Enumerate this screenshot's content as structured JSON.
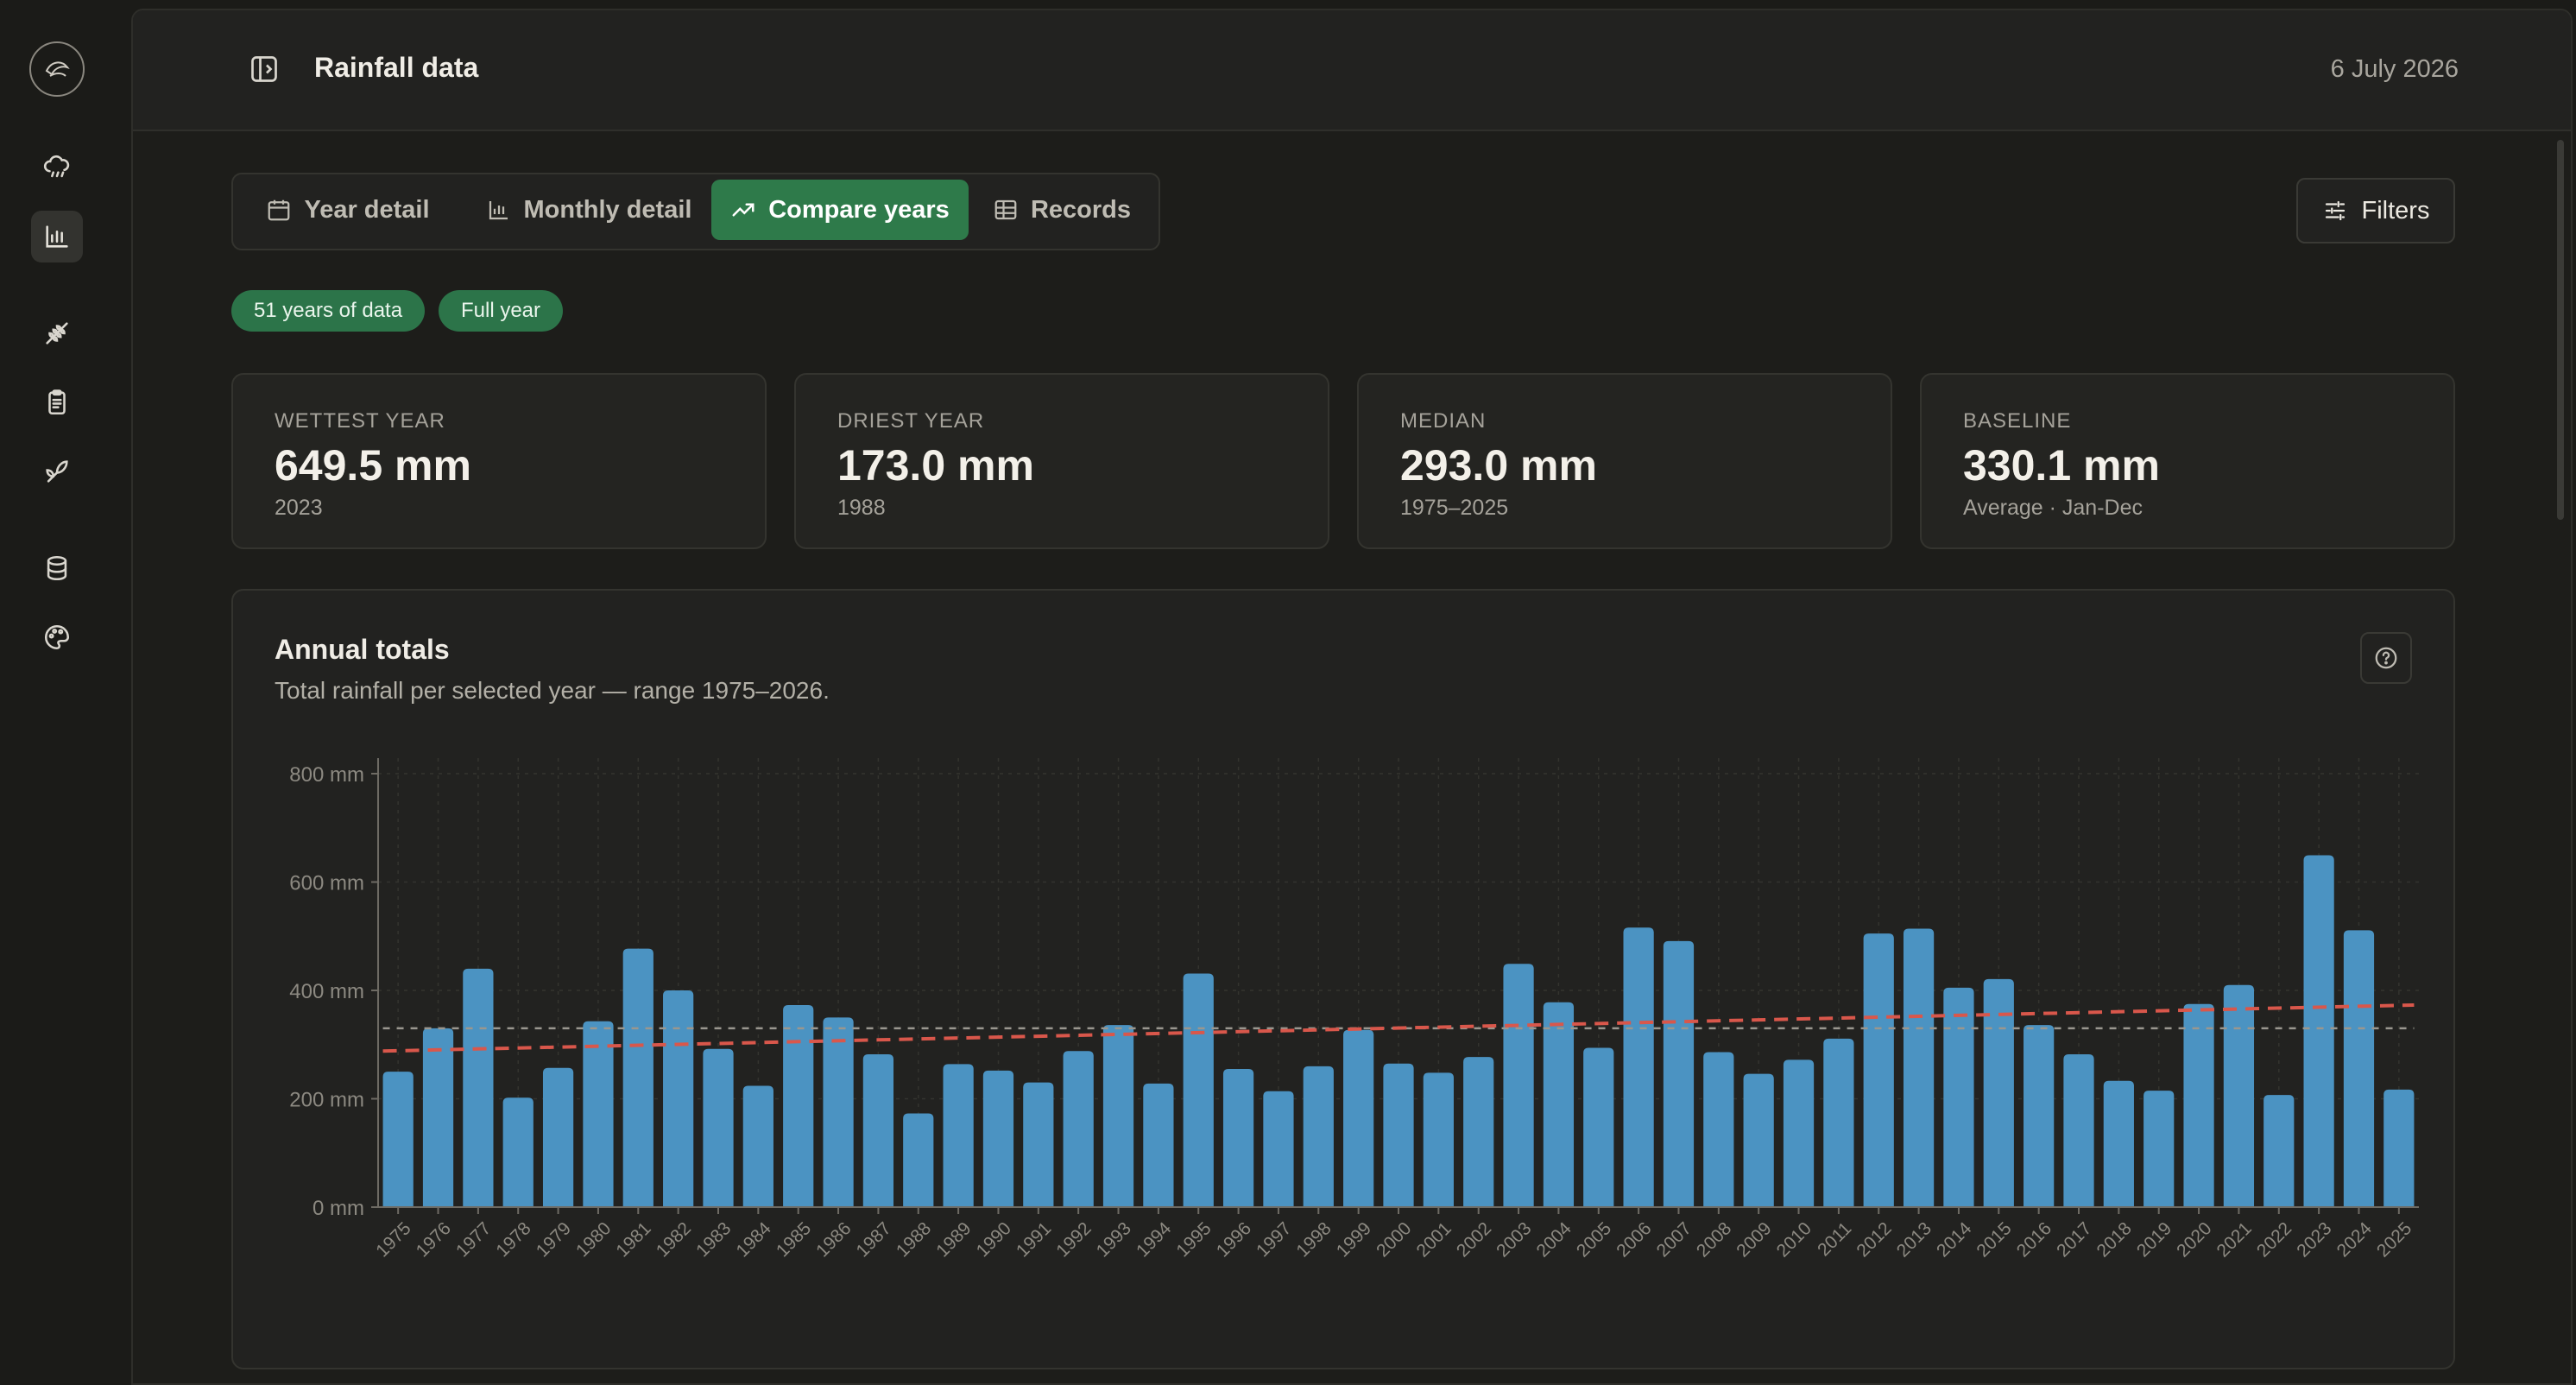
{
  "app": {
    "title": "Rainfall data",
    "date": "6 July 2026"
  },
  "rail": {
    "items": [
      {
        "icon": "logo-icon"
      },
      {
        "icon": "cloud-rain-icon"
      },
      {
        "icon": "bar-chart-icon",
        "active": true
      },
      {
        "icon": "wheat-icon"
      },
      {
        "icon": "clipboard-icon"
      },
      {
        "icon": "sprout-icon"
      },
      {
        "icon": "database-icon"
      },
      {
        "icon": "palette-icon"
      }
    ]
  },
  "tabs": [
    {
      "label": "Year detail",
      "icon": "calendar-icon"
    },
    {
      "label": "Monthly detail",
      "icon": "bar-chart-icon"
    },
    {
      "label": "Compare years",
      "icon": "trending-up-icon",
      "active": true
    },
    {
      "label": "Records",
      "icon": "table-icon"
    }
  ],
  "filters": {
    "label": "Filters",
    "icon": "sliders-icon"
  },
  "chips": [
    "51 years of data",
    "Full year"
  ],
  "stats": [
    {
      "label": "WETTEST YEAR",
      "value": "649.5 mm",
      "sub": "2023"
    },
    {
      "label": "DRIEST YEAR",
      "value": "173.0 mm",
      "sub": "1988"
    },
    {
      "label": "MEDIAN",
      "value": "293.0 mm",
      "sub": "1975–2025"
    },
    {
      "label": "BASELINE",
      "value": "330.1 mm",
      "sub": "Average · Jan-Dec"
    }
  ],
  "chart": {
    "title": "Annual totals",
    "subtitle": "Total rainfall per selected year — range 1975–2026."
  },
  "colors": {
    "accent": "#2e7a4a",
    "bar": "#4b93c2",
    "trend": "#d9574b",
    "baseline": "#9a978f"
  },
  "chart_data": {
    "type": "bar",
    "categories": [
      "1975",
      "1976",
      "1977",
      "1978",
      "1979",
      "1980",
      "1981",
      "1982",
      "1983",
      "1984",
      "1985",
      "1986",
      "1987",
      "1988",
      "1989",
      "1990",
      "1991",
      "1992",
      "1993",
      "1994",
      "1995",
      "1996",
      "1997",
      "1998",
      "1999",
      "2000",
      "2001",
      "2002",
      "2003",
      "2004",
      "2005",
      "2006",
      "2007",
      "2008",
      "2009",
      "2010",
      "2011",
      "2012",
      "2013",
      "2014",
      "2015",
      "2016",
      "2017",
      "2018",
      "2019",
      "2020",
      "2021",
      "2022",
      "2023",
      "2024",
      "2025"
    ],
    "values": [
      250,
      330,
      440,
      202,
      257,
      343,
      477,
      400,
      292,
      224,
      373,
      350,
      282,
      173,
      264,
      252,
      230,
      288,
      336,
      228,
      431,
      255,
      214,
      260,
      327,
      265,
      248,
      277,
      449,
      378,
      294,
      516,
      491,
      286,
      246,
      272,
      311,
      505,
      514,
      405,
      421,
      336,
      282,
      233,
      215,
      375,
      410,
      207,
      649.5,
      511,
      217
    ],
    "ylabel": "",
    "xlabel": "",
    "ylim": [
      0,
      800
    ],
    "yticks": [
      {
        "v": 0,
        "label": "0 mm"
      },
      {
        "v": 200,
        "label": "200 mm"
      },
      {
        "v": 400,
        "label": "400 mm"
      },
      {
        "v": 600,
        "label": "600 mm"
      },
      {
        "v": 800,
        "label": "800 mm"
      }
    ],
    "baseline": 330.1,
    "trend": {
      "start": 288,
      "end": 373
    },
    "grid": true,
    "legend": "none"
  }
}
